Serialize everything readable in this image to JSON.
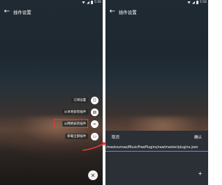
{
  "status": {
    "time": "5:56"
  },
  "appbar": {
    "title": "插件设置"
  },
  "fab_menu": {
    "items": [
      {
        "label": "订阅设置",
        "icon": "subscription-icon"
      },
      {
        "label": "从本地安装插件",
        "icon": "file-icon"
      },
      {
        "label": "从网络安装插件",
        "icon": "link-icon"
      },
      {
        "label": "卸载全部插件",
        "icon": "trash-icon"
      }
    ],
    "close_icon": "close-icon"
  },
  "dialog": {
    "cancel_label": "取消",
    "confirm_label": "确认",
    "url_value": "/maotoumao/MusicFreePlugins/raw/master/plugins.json",
    "add_icon": "plus-icon"
  },
  "colors": {
    "highlight": "#e53935",
    "accent": "#4a9ee8",
    "dialog_bg": "#2b2f36"
  }
}
